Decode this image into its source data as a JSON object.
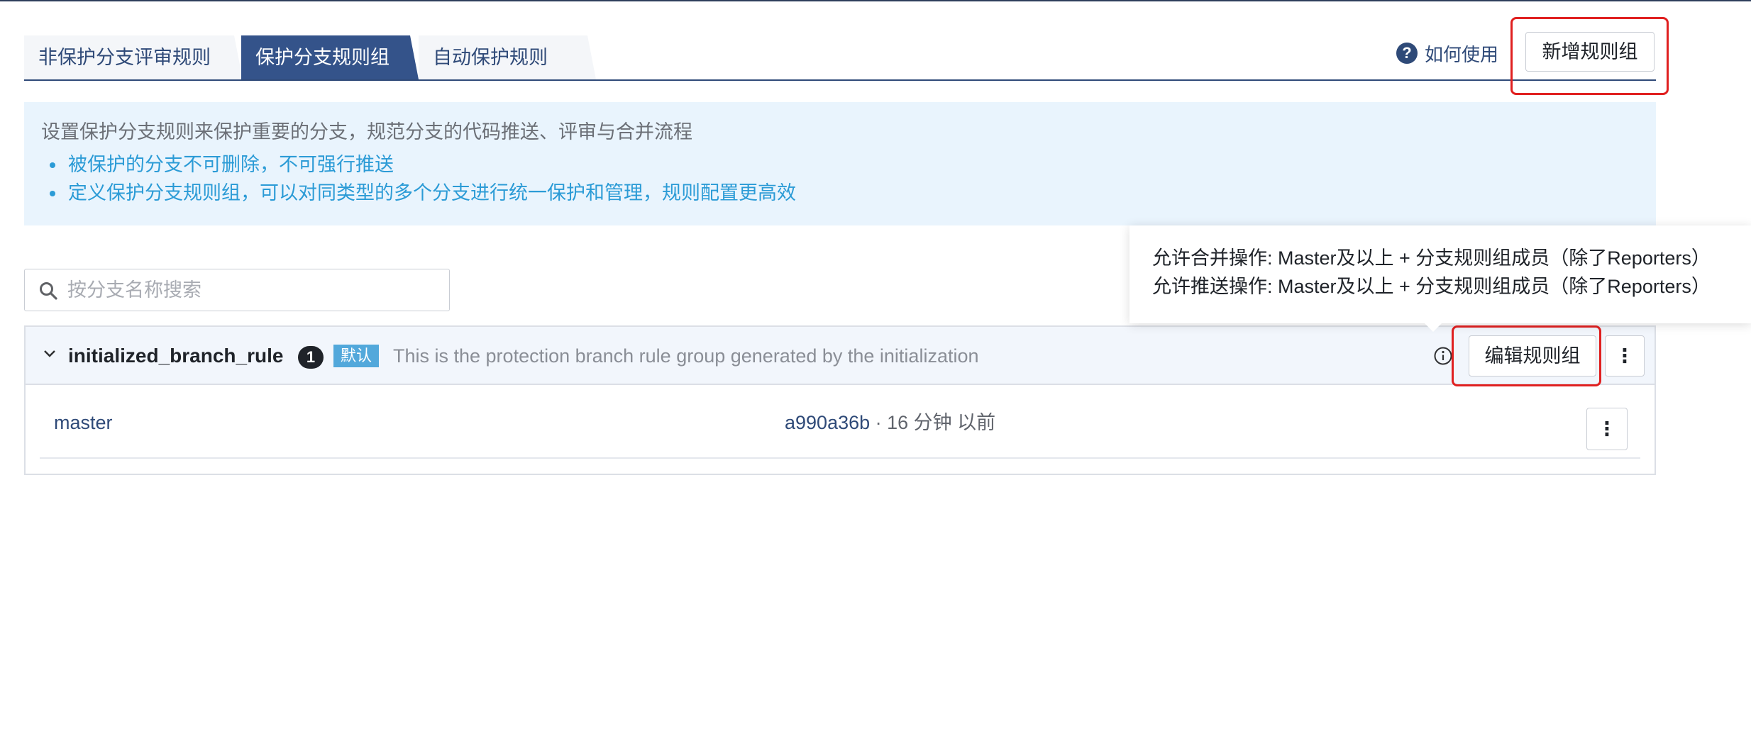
{
  "tabs": [
    {
      "label": "非保护分支评审规则",
      "active": false
    },
    {
      "label": "保护分支规则组",
      "active": true
    },
    {
      "label": "自动保护规则",
      "active": false
    }
  ],
  "header": {
    "help_label": "如何使用",
    "help_icon": "question-circle-icon",
    "new_group_label": "新增规则组"
  },
  "info": {
    "title": "设置保护分支规则来保护重要的分支，规范分支的代码推送、评审与合并流程",
    "bullets": [
      "被保护的分支不可删除，不可强行推送",
      "定义保护分支规则组，可以对同类型的多个分支进行统一保护和管理，规则配置更高效"
    ]
  },
  "search": {
    "placeholder": "按分支名称搜索",
    "value": ""
  },
  "tooltip": {
    "lines": [
      "允许合并操作: Master及以上 + 分支规则组成员（除了Reporters）",
      "允许推送操作: Master及以上 + 分支规则组成员（除了Reporters）"
    ]
  },
  "rule_group": {
    "name": "initialized_branch_rule",
    "count": "1",
    "default_tag": "默认",
    "description": "This is the protection branch rule group generated by the initialization",
    "edit_label": "编辑规则组",
    "more_label": "⋮",
    "branches": [
      {
        "name": "master",
        "commit": "a990a36b",
        "time": " · 16 分钟 以前",
        "more_label": "⋮"
      }
    ]
  },
  "colors": {
    "primary": "#34538a",
    "link": "#2f4a78",
    "info_bg": "#e9f4fd",
    "info_text": "#2b9bd6",
    "highlight": "#e02020"
  }
}
